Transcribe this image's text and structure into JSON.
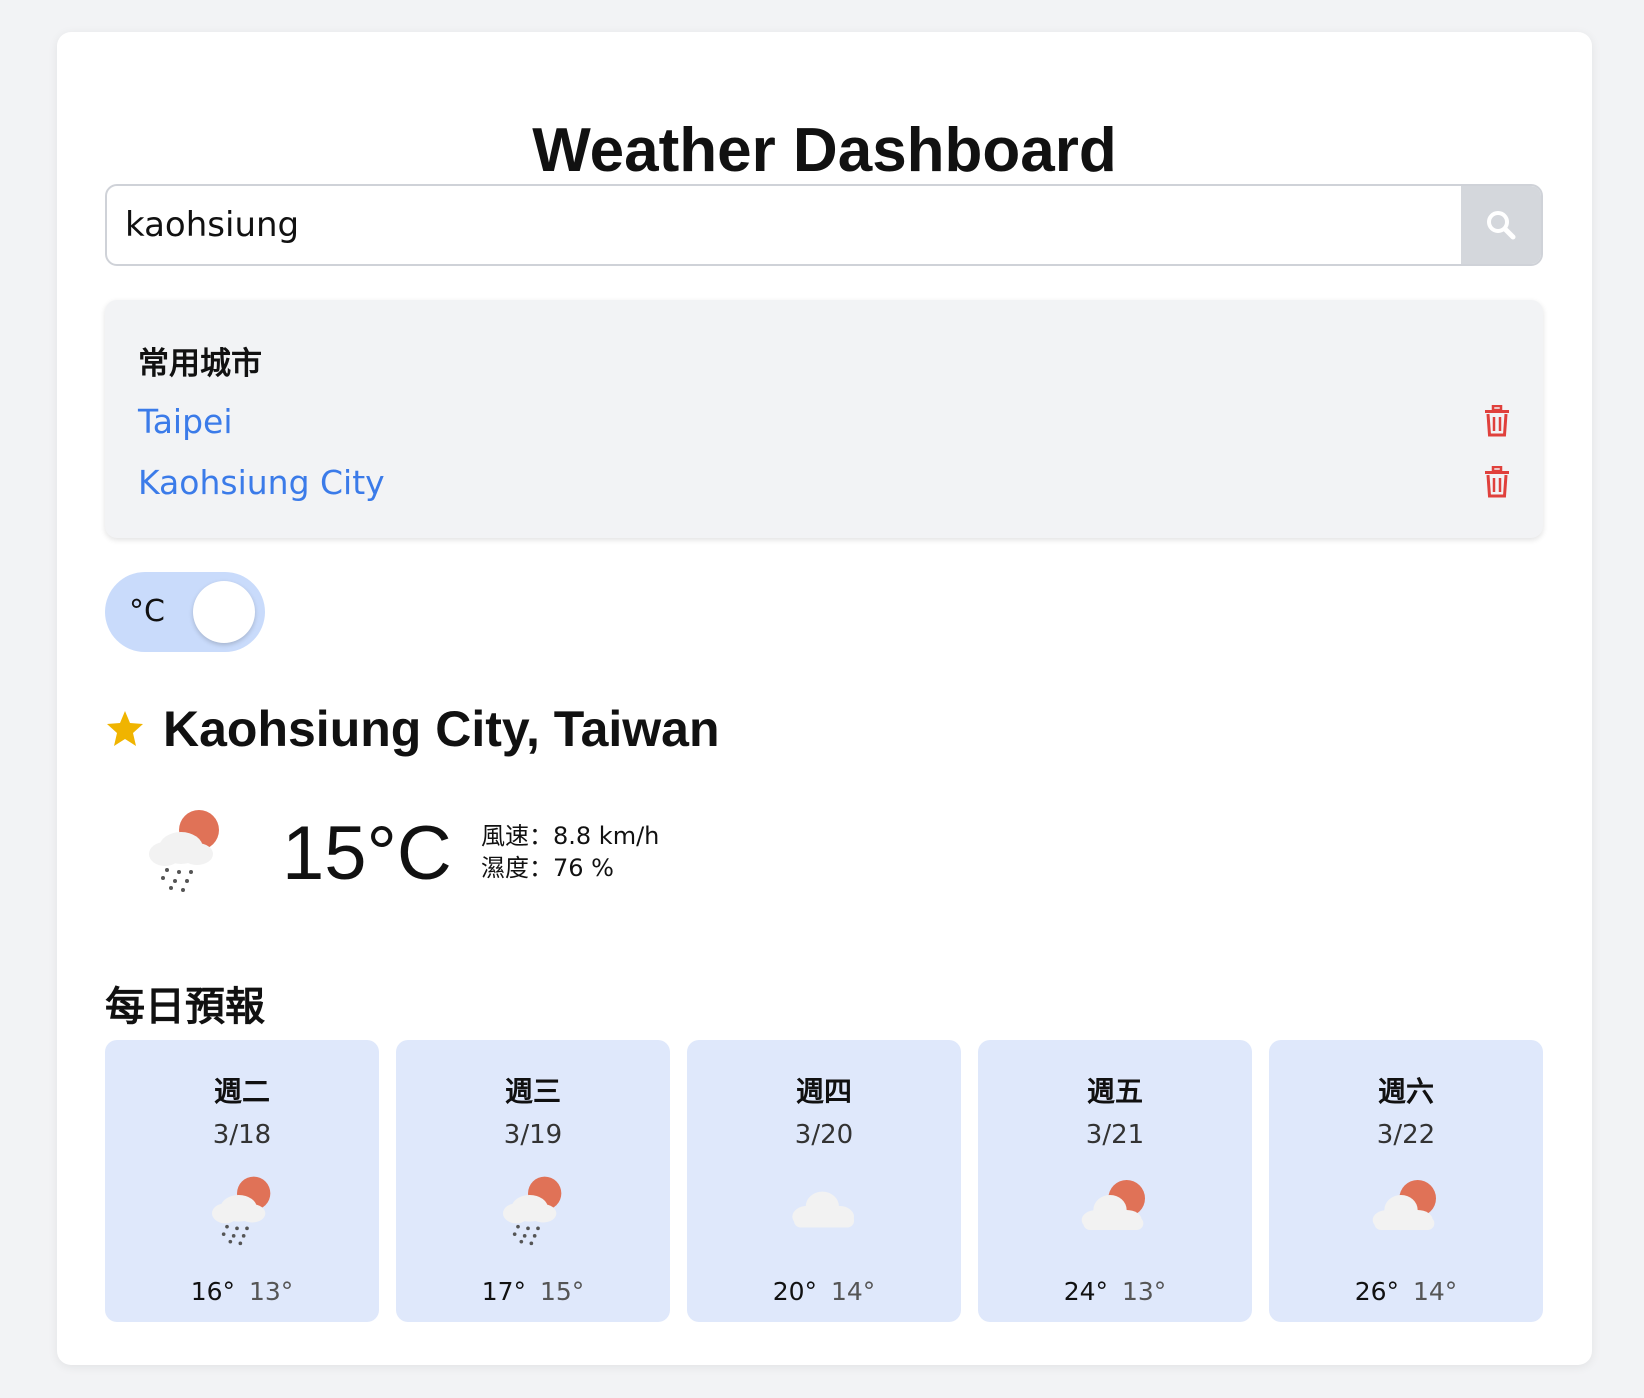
{
  "app": {
    "title": "Weather Dashboard"
  },
  "search": {
    "value": "kaohsiung",
    "icon": "search-icon"
  },
  "favorites": {
    "title": "常用城市",
    "items": [
      {
        "name": "Taipei"
      },
      {
        "name": "Kaohsiung City"
      }
    ]
  },
  "unit_toggle": {
    "label": "°C"
  },
  "current": {
    "location": "Kaohsiung City, Taiwan",
    "favorite": true,
    "temperature": "15°C",
    "wind": "風速：8.8 km/h",
    "humidity": "濕度：76 %",
    "icon": "rain-sun-icon"
  },
  "daily": {
    "title": "每日預報",
    "days": [
      {
        "day": "週二",
        "date": "3/18",
        "hi": "16°",
        "lo": "13°",
        "icon": "rain-sun-icon"
      },
      {
        "day": "週三",
        "date": "3/19",
        "hi": "17°",
        "lo": "15°",
        "icon": "rain-sun-icon"
      },
      {
        "day": "週四",
        "date": "3/20",
        "hi": "20°",
        "lo": "14°",
        "icon": "cloud-icon"
      },
      {
        "day": "週五",
        "date": "3/21",
        "hi": "24°",
        "lo": "13°",
        "icon": "partly-cloudy-icon"
      },
      {
        "day": "週六",
        "date": "3/22",
        "hi": "26°",
        "lo": "14°",
        "icon": "partly-cloudy-icon"
      }
    ]
  },
  "colors": {
    "accent": "#3b7be9",
    "delete": "#e0403c",
    "star": "#f0b400",
    "day_card": "#dfe8fb",
    "toggle": "#c9dbfb"
  }
}
